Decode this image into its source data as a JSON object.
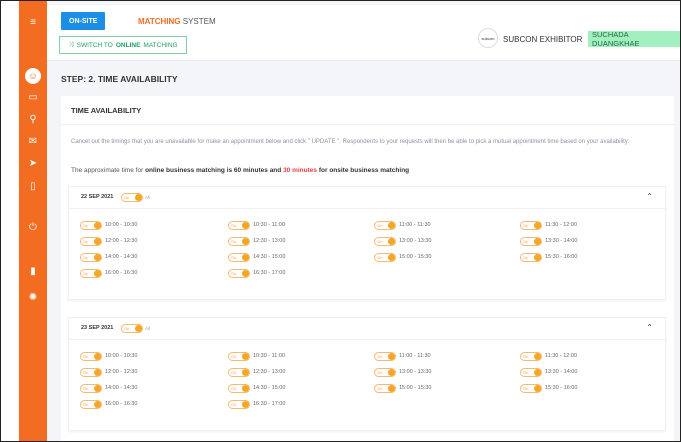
{
  "header": {
    "onsite_label": "ON-SITE",
    "title_main": "MATCHING",
    "title_sub": "SYSTEM",
    "switch_prefix": "SWITCH TO",
    "switch_bold": "ONLINE",
    "switch_suffix": "MATCHING",
    "logo_text": "subcon",
    "role": "SUBCON EXHIBITOR",
    "user": "SUCHADA DUANGKHAE"
  },
  "step_title": "STEP: 2. TIME AVAILABILITY",
  "card": {
    "title": "TIME AVAILABILITY",
    "description": "Cancel out the timings that you are unavailable for make an appointment below and click \" UPDATE \". Respondents to your requests will then be able to pick a mutual appointment time based on your availability.",
    "approx_prefix": "The approximate time for",
    "approx_bold": "online business matching is 60 minutes and",
    "approx_red": "30 minutes",
    "approx_suffix": "for onsite business matching"
  },
  "toggle": {
    "on_label": "On",
    "all_label": "All"
  },
  "days": [
    {
      "date": "22 SEP 2021",
      "slots": [
        "10:00 - 10:30",
        "10:30 - 11:00",
        "11:00 - 11:30",
        "11:30 - 12:00",
        "12:00 - 12:30",
        "12:30 - 13:00",
        "13:00 - 13:30",
        "13:30 - 14:00",
        "14:00 - 14:30",
        "14:30 - 15:00",
        "15:00 - 15:30",
        "15:30 - 16:00",
        "16:00 - 16:30",
        "16:30 - 17:00"
      ]
    },
    {
      "date": "23 SEP 2021",
      "slots": [
        "10:00 - 10:30",
        "10:30 - 11:00",
        "11:00 - 11:30",
        "11:30 - 12:00",
        "12:00 - 12:30",
        "12:30 - 13:00",
        "13:00 - 13:30",
        "13:30 - 14:00",
        "14:00 - 14:30",
        "14:30 - 15:00",
        "15:00 - 15:30",
        "15:30 - 16:00",
        "16:00 - 16:30",
        "16:30 - 17:00"
      ]
    }
  ],
  "colors": {
    "accent": "#f26c21",
    "primary": "#1b8fe6",
    "success": "#21a160",
    "toggle": "#f5a623"
  }
}
